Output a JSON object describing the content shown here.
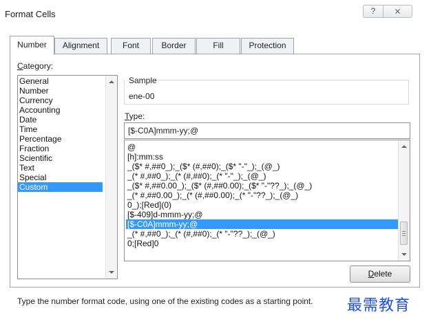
{
  "window": {
    "title": "Format Cells",
    "help_glyph": "?",
    "close_glyph": "⨯"
  },
  "tabs": [
    {
      "label": "Number",
      "active": true
    },
    {
      "label": "Alignment",
      "active": false
    },
    {
      "label": "Font",
      "active": false
    },
    {
      "label": "Border",
      "active": false
    },
    {
      "label": "Fill",
      "active": false
    },
    {
      "label": "Protection",
      "active": false
    }
  ],
  "category": {
    "label_first": "C",
    "label_rest": "ategory:",
    "items": [
      "General",
      "Number",
      "Currency",
      "Accounting",
      "Date",
      "Time",
      "Percentage",
      "Fraction",
      "Scientific",
      "Text",
      "Special",
      "Custom"
    ],
    "selected": "Custom"
  },
  "sample": {
    "label": "Sample",
    "value": "ene-00"
  },
  "type": {
    "label_first": "T",
    "label_rest": "ype:",
    "value": "[$-C0A]mmm-yy;@"
  },
  "format_list": {
    "items": [
      "@",
      "[h]:mm:ss",
      "_($* #,##0_);_($* (#,##0);_($* \"-\"_);_(@_)",
      "_(* #,##0_);_(* (#,##0);_(* \"-\"_);_(@_)",
      "_($* #,##0.00_);_($* (#,##0.00);_($* \"-\"??_);_(@_)",
      "_(* #,##0.00_);_(* (#,##0.00);_(* \"-\"??_);_(@_)",
      "0_);[Red](0)",
      "[$-409]d-mmm-yy;@",
      "[$-C0A]mmm-yy;@",
      "_(* #,##0_);_(* (#,##0);_(* \"-\"??_);_(@_)",
      "0;[Red]0"
    ],
    "selected": "[$-C0A]mmm-yy;@"
  },
  "delete_button": {
    "label_first": "D",
    "label_rest": "elete"
  },
  "hint": "Type the number format code, using one of the existing codes as a starting point.",
  "watermark": "最需教育",
  "colors": {
    "selection": "#3399ff",
    "watermark": "#1f4fd8",
    "border": "#9ea3aa"
  }
}
